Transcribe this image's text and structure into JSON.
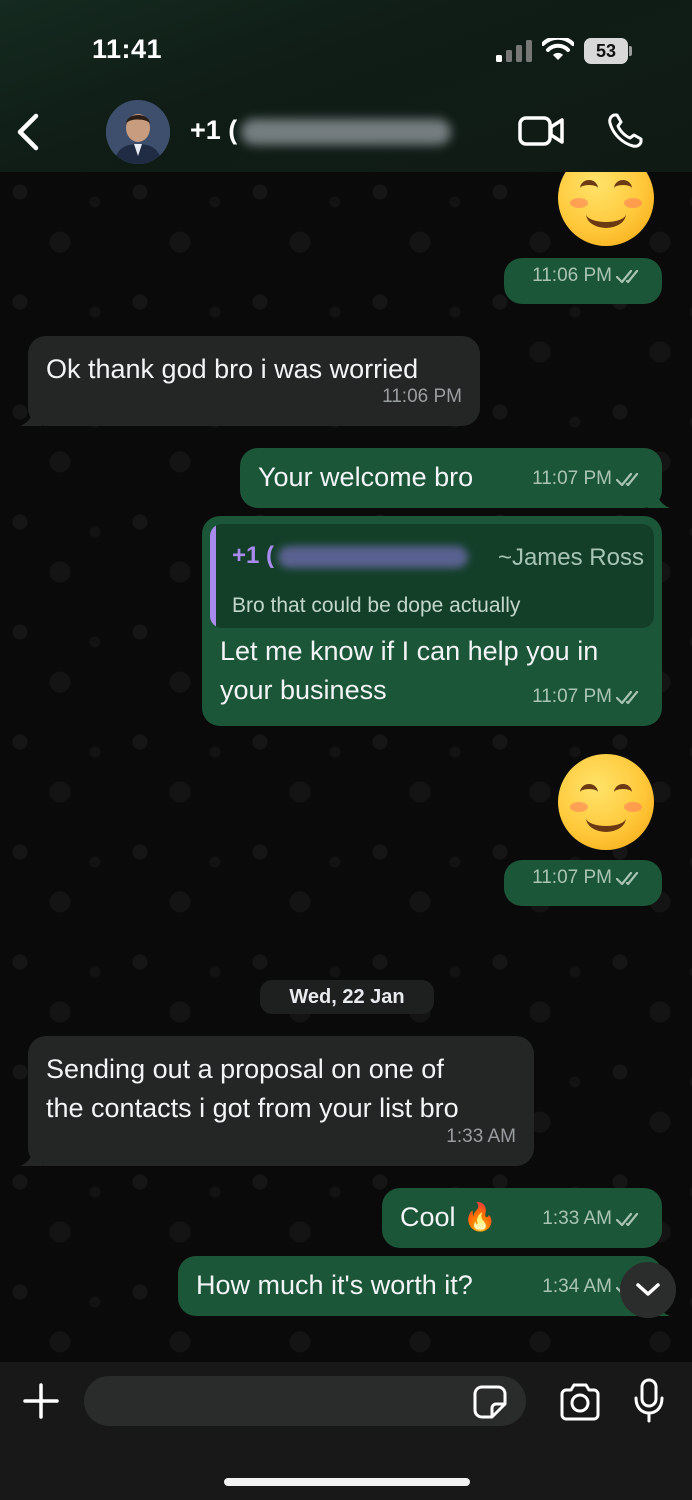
{
  "status_bar": {
    "time": "11:41",
    "battery": "53"
  },
  "header": {
    "contact_prefix": "+1 ("
  },
  "messages": [
    {
      "kind": "emoji-out",
      "time": "11:06 PM"
    },
    {
      "kind": "in",
      "text": "Ok thank god bro i was worried",
      "time": "11:06 PM"
    },
    {
      "kind": "out",
      "text": "Your welcome bro",
      "time": "11:07 PM"
    },
    {
      "kind": "out-reply",
      "quote": {
        "sender_prefix": "+1 (",
        "alias": "~James  Ross",
        "text": "Bro that could be dope actually"
      },
      "text": "Let me know if I can help you in\nyour business",
      "time": "11:07 PM"
    },
    {
      "kind": "emoji-out",
      "time": "11:07 PM"
    },
    {
      "kind": "date",
      "label": "Wed, 22 Jan"
    },
    {
      "kind": "in",
      "text": "Sending out a proposal on one of\nthe contacts i got from your list bro",
      "time": "1:33 AM"
    },
    {
      "kind": "out",
      "text": "Cool 🔥",
      "time": "1:33 AM"
    },
    {
      "kind": "out",
      "text": "How much it's worth it?",
      "time": "1:34 AM"
    }
  ],
  "composer": {
    "placeholder": ""
  },
  "colors": {
    "outgoing": "#1c5638",
    "incoming": "#242626",
    "quote_accent": "#a98bf0"
  }
}
